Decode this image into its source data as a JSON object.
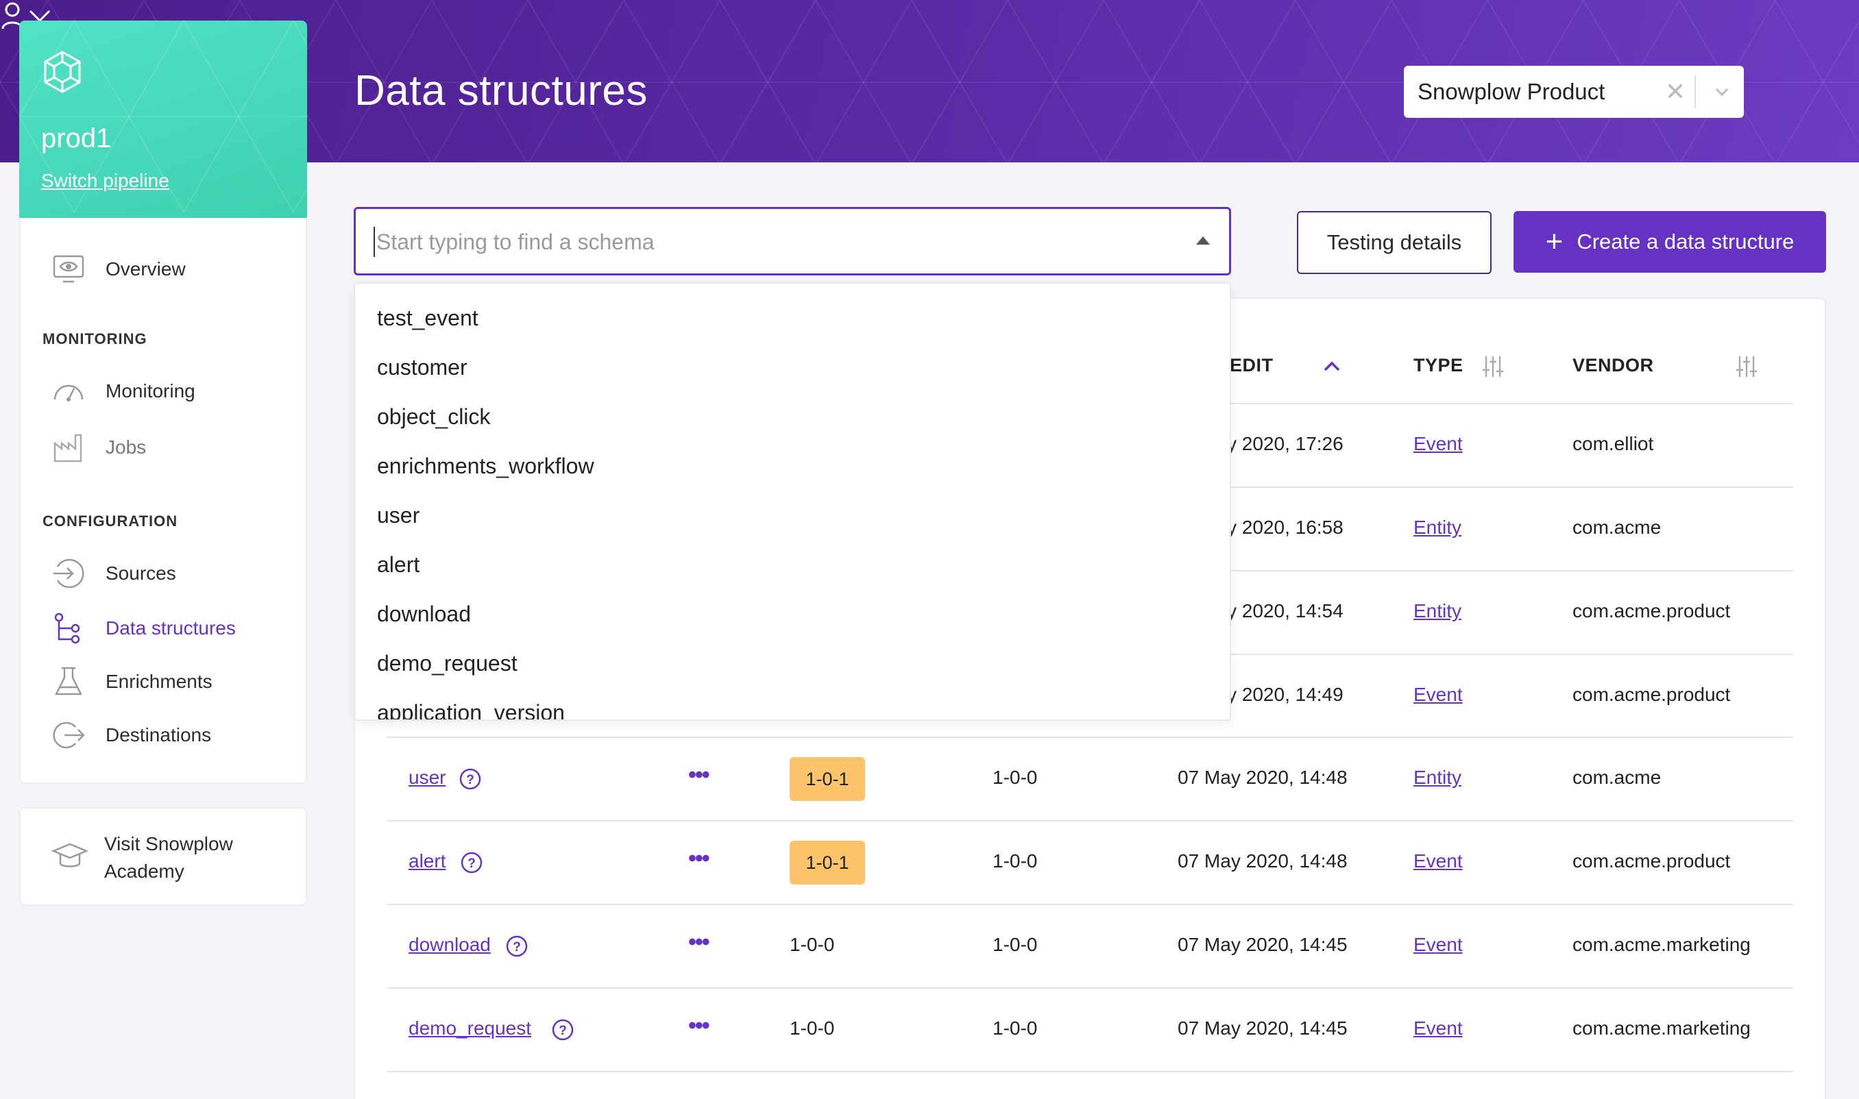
{
  "header": {
    "title": "Data structures",
    "org_selector": {
      "value": "Snowplow Product",
      "clear_icon": "close-icon",
      "dropdown_icon": "chevron-down-icon"
    },
    "user_icon": "user-icon"
  },
  "pipeline": {
    "name": "prod1",
    "switch_label": "Switch pipeline",
    "logo_icon": "snowplow-logo-icon"
  },
  "sidebar": {
    "overview": {
      "label": "Overview",
      "icon": "monitor-eye-icon"
    },
    "monitoring_heading": "MONITORING",
    "monitoring": {
      "label": "Monitoring",
      "icon": "gauge-icon"
    },
    "jobs": {
      "label": "Jobs",
      "icon": "factory-icon"
    },
    "configuration_heading": "CONFIGURATION",
    "sources": {
      "label": "Sources",
      "icon": "source-arrow-icon"
    },
    "data_structures": {
      "label": "Data structures",
      "icon": "tree-structure-icon"
    },
    "enrichments": {
      "label": "Enrichments",
      "icon": "flask-icon"
    },
    "destinations": {
      "label": "Destinations",
      "icon": "destination-arrow-icon"
    },
    "active_color": "#6732c4"
  },
  "academy": {
    "label": "Visit Snowplow Academy",
    "icon": "graduation-cap-icon"
  },
  "search": {
    "placeholder": "Start typing to find a schema",
    "value": ""
  },
  "buttons": {
    "testing_details": "Testing details",
    "create": "Create a data structure",
    "create_icon": "plus-icon"
  },
  "dropdown": {
    "items": [
      "test_event",
      "customer",
      "object_click",
      "enrichments_workflow",
      "user",
      "alert",
      "download",
      "demo_request",
      "application_version"
    ]
  },
  "table": {
    "headers": {
      "last_edit_partial": "EDIT",
      "type": "TYPE",
      "vendor": "VENDOR",
      "sort_icon": "chevron-up-icon",
      "filter_icon": "sliders-icon"
    },
    "hidden_rows": [
      {
        "date": "y 2020, 17:26",
        "type": "Event",
        "vendor": "com.elliot"
      },
      {
        "date": "y 2020, 16:58",
        "type": "Entity",
        "vendor": "com.acme"
      },
      {
        "date": "y 2020, 14:54",
        "type": "Entity",
        "vendor": "com.acme.product"
      },
      {
        "date": "y 2020, 14:49",
        "type": "Event",
        "vendor": "com.acme.product"
      }
    ],
    "rows": [
      {
        "name": "user",
        "version": "1-0-1",
        "version_highlight": true,
        "deployed": "1-0-0",
        "date": "07 May 2020, 14:48",
        "type": "Entity",
        "vendor": "com.acme"
      },
      {
        "name": "alert",
        "version": "1-0-1",
        "version_highlight": true,
        "deployed": "1-0-0",
        "date": "07 May 2020, 14:48",
        "type": "Event",
        "vendor": "com.acme.product"
      },
      {
        "name": "download",
        "version": "1-0-0",
        "version_highlight": false,
        "deployed": "1-0-0",
        "date": "07 May 2020, 14:45",
        "type": "Event",
        "vendor": "com.acme.marketing"
      },
      {
        "name": "demo_request",
        "version": "1-0-0",
        "version_highlight": false,
        "deployed": "1-0-0",
        "date": "07 May 2020, 14:45",
        "type": "Event",
        "vendor": "com.acme.marketing"
      }
    ],
    "help_icon": "question-circle-icon",
    "more_icon": "more-dots-icon",
    "highlight_color": "#fcc46a"
  }
}
